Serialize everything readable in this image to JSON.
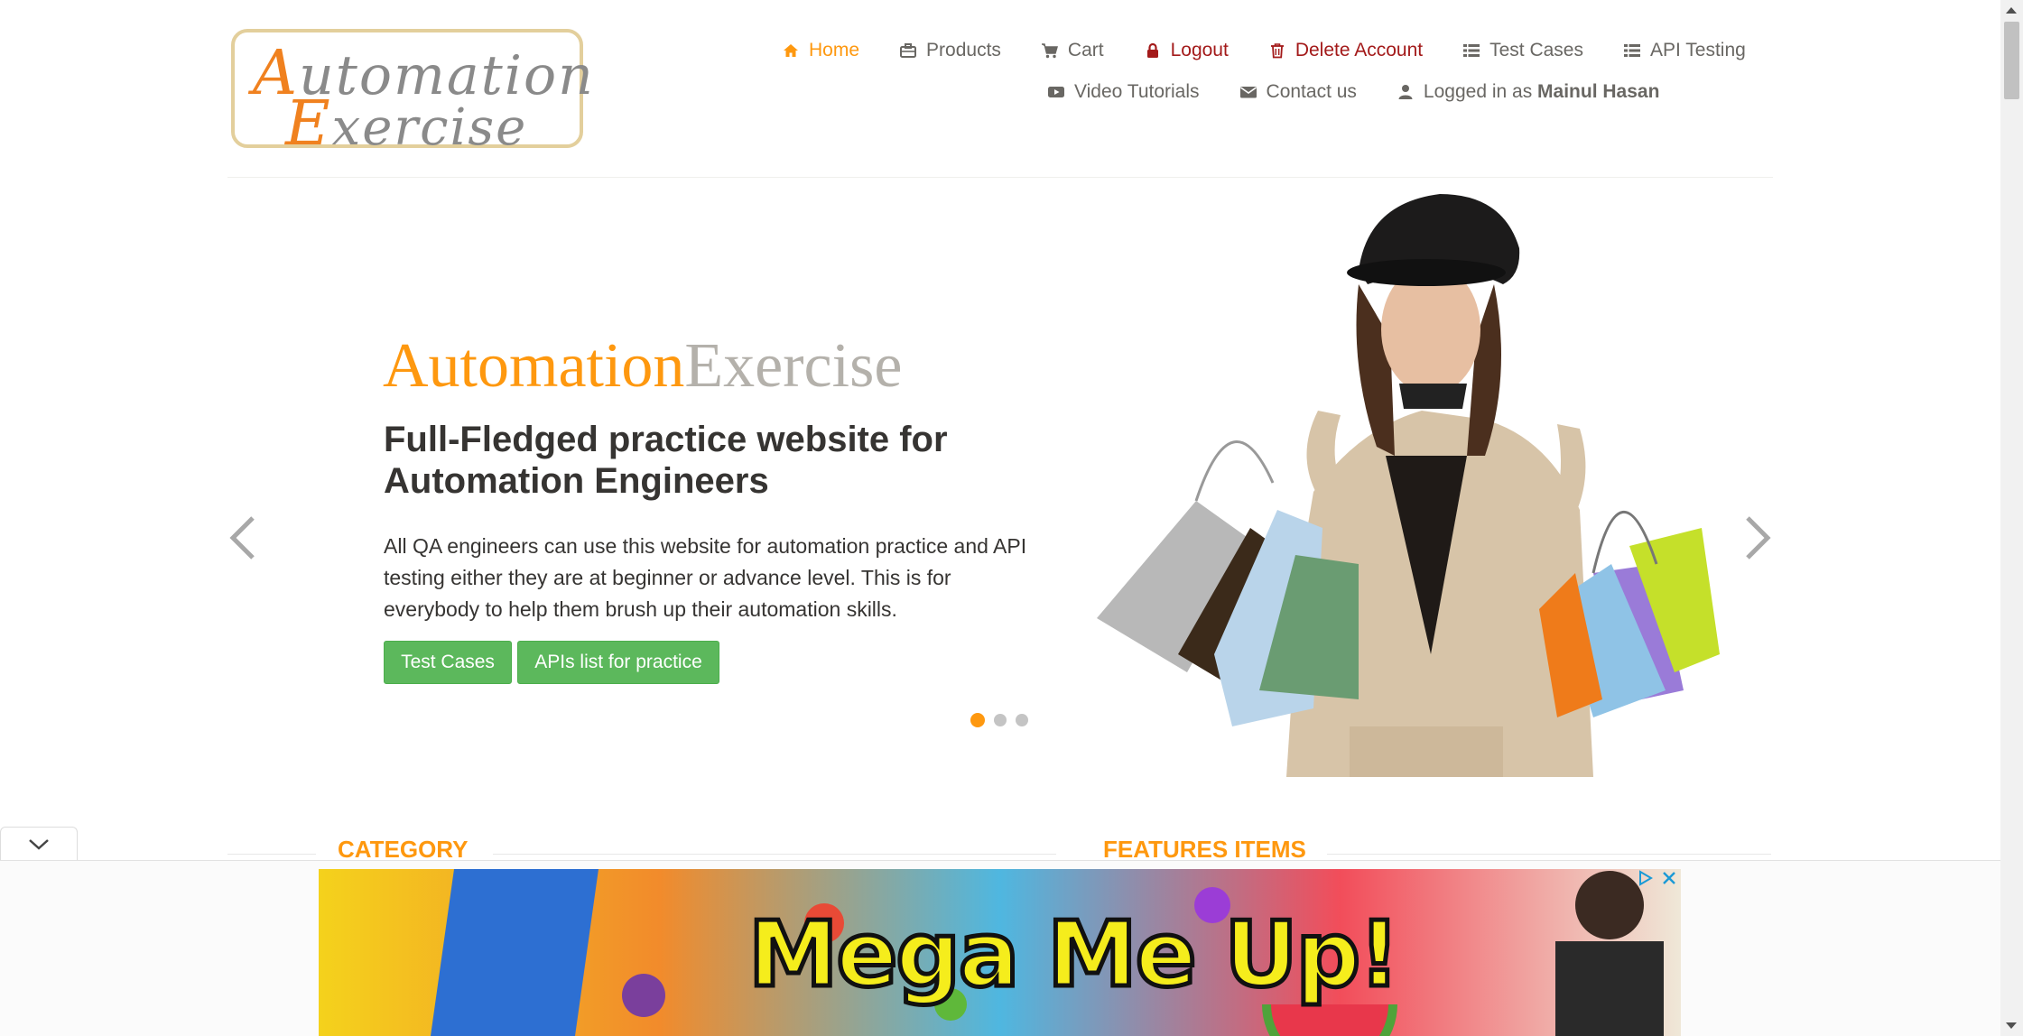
{
  "logo": {
    "line1_cap": "A",
    "line1_rest": "utomation",
    "line2_cap": "E",
    "line2_rest": "xercise"
  },
  "nav": {
    "row1": [
      {
        "label": "Home",
        "icon": "home-icon"
      },
      {
        "label": "Products",
        "icon": "briefcase-icon"
      },
      {
        "label": "Cart",
        "icon": "cart-icon"
      },
      {
        "label": "Logout",
        "icon": "lock-icon"
      },
      {
        "label": "Delete Account",
        "icon": "trash-icon"
      },
      {
        "label": "Test Cases",
        "icon": "list-icon"
      },
      {
        "label": "API Testing",
        "icon": "list-icon"
      }
    ],
    "row2": [
      {
        "label": "Video Tutorials",
        "icon": "youtube-play-icon"
      },
      {
        "label": "Contact us",
        "icon": "envelope-icon"
      },
      {
        "label_prefix": "Logged in as ",
        "user": "Mainul Hasan",
        "icon": "user-icon"
      }
    ]
  },
  "hero": {
    "brand_orange": "Automation",
    "brand_gray": "Exercise",
    "heading": "Full-Fledged practice website for Automation Engineers",
    "description": "All QA engineers can use this website for automation practice and API testing either they are at beginner or advance level. This is for everybody to help them brush up their automation skills.",
    "btn_test_cases": "Test Cases",
    "btn_apis": "APIs list for practice",
    "slide_count": 3,
    "active_slide": 1
  },
  "sections": {
    "category": "CATEGORY",
    "features": "FEATURES ITEMS"
  },
  "ad": {
    "text": "Mega Me Up!"
  },
  "colors": {
    "accent": "#fe980f",
    "danger": "#a31a1a",
    "button": "#5cb85c",
    "text": "#696763",
    "heading": "#363432"
  }
}
